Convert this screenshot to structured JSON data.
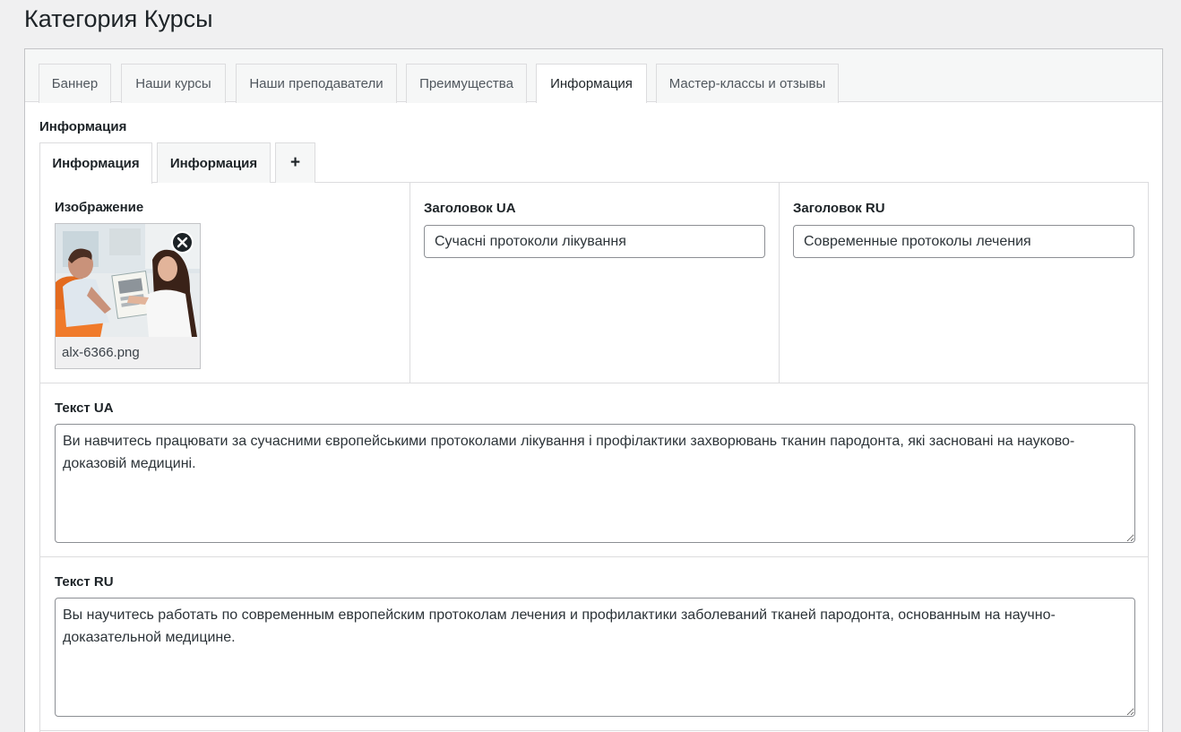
{
  "page": {
    "title": "Категория Курсы"
  },
  "tabs": [
    {
      "label": "Баннер"
    },
    {
      "label": "Наши курсы"
    },
    {
      "label": "Наши преподаватели"
    },
    {
      "label": "Преимущества"
    },
    {
      "label": "Информация",
      "active": true
    },
    {
      "label": "Мастер-классы и отзывы"
    }
  ],
  "section": {
    "label": "Информация"
  },
  "subtabs": [
    {
      "label": "Информация",
      "active": true
    },
    {
      "label": "Информация"
    },
    {
      "label": "+"
    }
  ],
  "fields": {
    "image": {
      "label": "Изображение",
      "filename": "alx-6366.png"
    },
    "title_ua": {
      "label": "Заголовок UA",
      "value": "Сучасні протоколи лікування"
    },
    "title_ru": {
      "label": "Заголовок RU",
      "value": "Современные протоколы лечения"
    },
    "text_ua": {
      "label": "Текст UA",
      "value": "Ви навчитесь працювати за сучасними європейськими протоколами лікування і профілактики захворювань тканин пародонта, які засновані на науково-доказовій медицині."
    },
    "text_ru": {
      "label": "Текст RU",
      "value": "Вы научитесь работать по современным европейским протоколам лечения и профилактики заболеваний тканей пародонта, основанным на научно-доказательной медицине."
    }
  },
  "colors": {
    "accent": "#2271b1",
    "border": "#dcdcde",
    "background": "#f0f0f1"
  },
  "icons": {
    "remove": "close-icon",
    "image": "photo-thumbnail"
  }
}
